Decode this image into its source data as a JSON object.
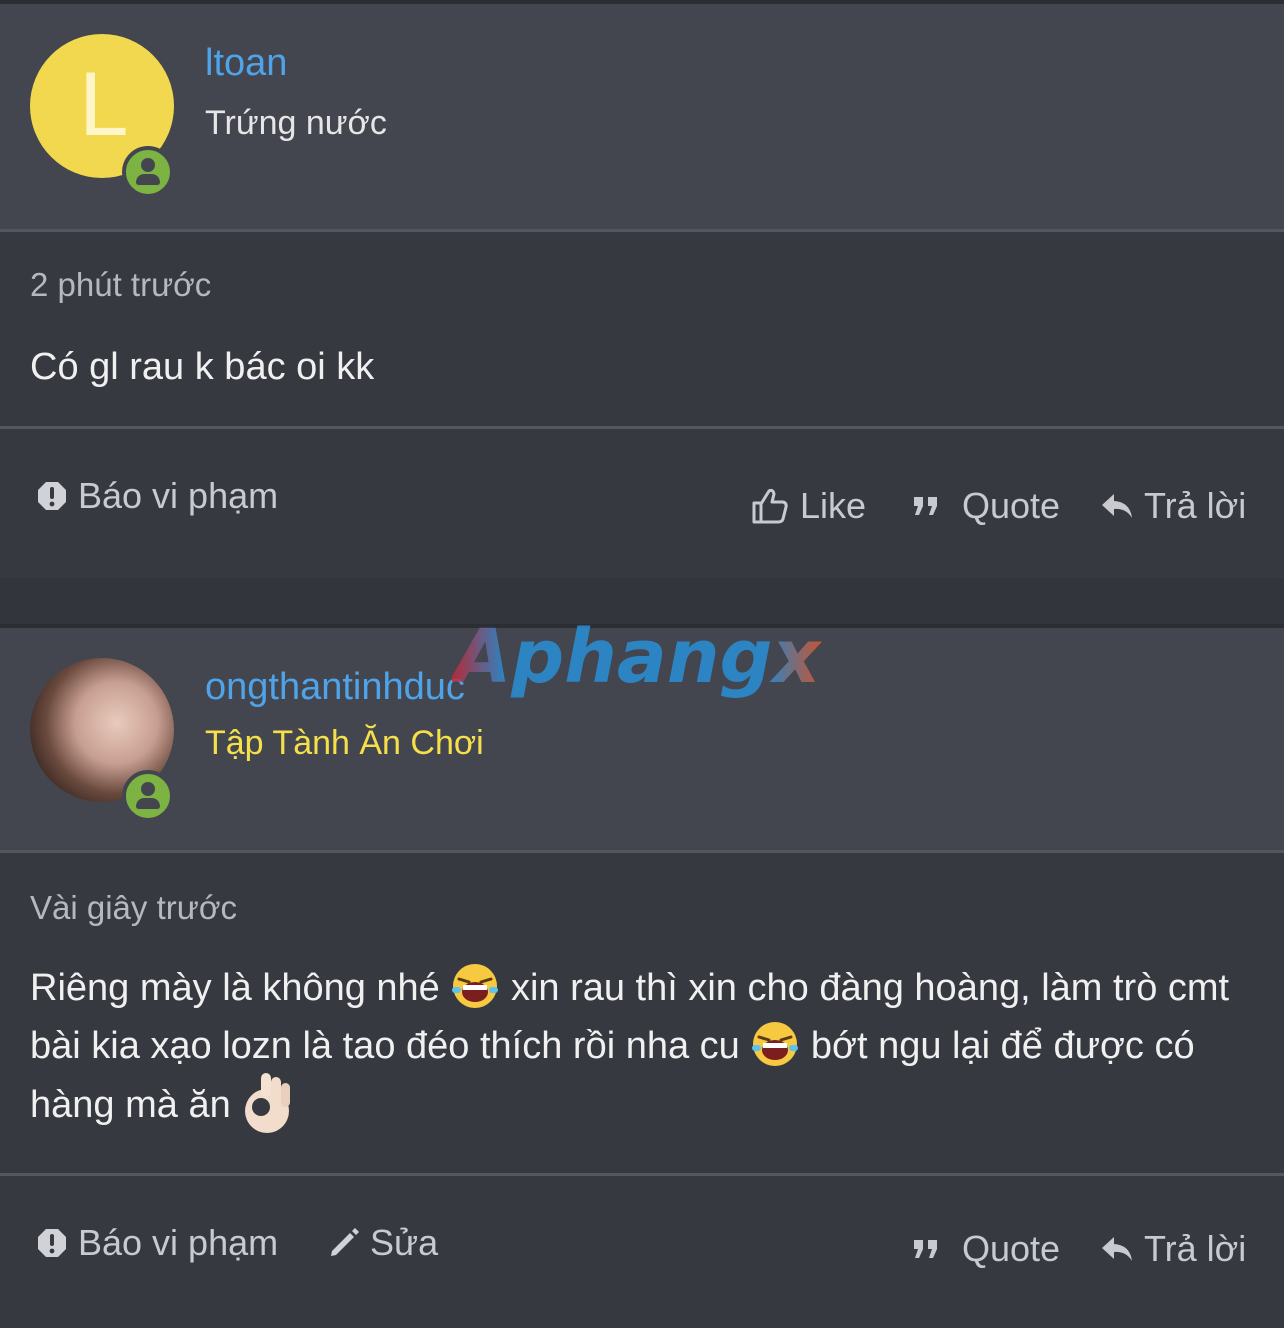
{
  "posts": [
    {
      "avatar_letter": "L",
      "username": "ltoan",
      "user_title": "Trứng nước",
      "time": "2 phút trước",
      "message": "Có gl rau k bác oi kk",
      "actions_left": {
        "report": "Báo vi phạm"
      },
      "actions_right": {
        "like": "Like",
        "quote": "Quote",
        "reply": "Trả lời"
      }
    },
    {
      "username": "ongthantinhduc",
      "user_title": "Tập Tành Ăn Chơi",
      "time": "Vài giây trước",
      "message": {
        "part1": "Riêng mày là không nhé",
        "part2": " xin rau thì xin cho đàng hoàng, làm trò cmt bài kia xạo lozn là tao đéo thích rồi nha cu",
        "part3": " bớt ngu lại để được có hàng mà ăn"
      },
      "actions_left": {
        "report": "Báo vi phạm",
        "edit": "Sửa"
      },
      "actions_right": {
        "quote": "Quote",
        "reply": "Trả lời"
      }
    }
  ],
  "watermark": {
    "text": "Aphangx"
  },
  "colors": {
    "username": "#4fa3e8",
    "rank_title": "#f5e04a",
    "online": "#7cb342",
    "avatar_bg": "#f2d84e"
  },
  "icons": [
    "user-online-icon",
    "alert-icon",
    "thumbs-up-icon",
    "quote-icon",
    "reply-icon",
    "pencil-icon",
    "laughing-emoji-icon",
    "ok-hand-emoji-icon"
  ]
}
